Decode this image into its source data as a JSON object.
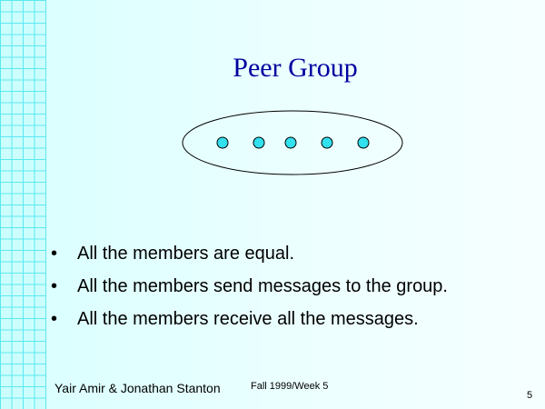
{
  "slide": {
    "title": "Peer Group",
    "bullets": [
      "All the members are equal.",
      "All the members send messages to the group.",
      "All the members receive all the messages."
    ],
    "footer": {
      "author": "Yair Amir & Jonathan Stanton",
      "date": "Fall 1999/Week 5",
      "page": "5"
    }
  },
  "diagram": {
    "group": "Peer Group",
    "member_count": 5,
    "member_color": "#33e0ee",
    "outline_color": "#000000"
  },
  "colors": {
    "title": "#0000a0",
    "background": "#eaffff",
    "grid_lines": "#5ce8f0"
  }
}
